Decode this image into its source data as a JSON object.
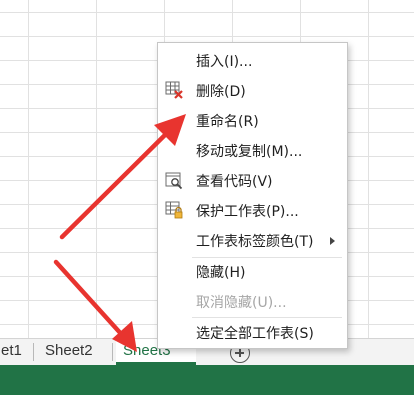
{
  "sheet_tabs": [
    "et1",
    "Sheet2",
    "Sheet3"
  ],
  "active_tab_index": 2,
  "status_text": "",
  "context_menu": {
    "items": [
      {
        "label": "插入(I)...",
        "icon": "insert",
        "disabled": false,
        "submenu": false
      },
      {
        "label": "删除(D)",
        "icon": "delete-sheet-icon",
        "disabled": false,
        "submenu": false
      },
      {
        "label": "重命名(R)",
        "icon": "",
        "disabled": false,
        "submenu": false
      },
      {
        "label": "移动或复制(M)...",
        "icon": "",
        "disabled": false,
        "submenu": false
      },
      {
        "label": "查看代码(V)",
        "icon": "view-code-icon",
        "disabled": false,
        "submenu": false
      },
      {
        "label": "保护工作表(P)...",
        "icon": "protect-sheet-icon",
        "disabled": false,
        "submenu": false
      },
      {
        "label": "工作表标签颜色(T)",
        "icon": "",
        "disabled": false,
        "submenu": true
      },
      {
        "label": "隐藏(H)",
        "icon": "",
        "disabled": false,
        "submenu": false
      },
      {
        "label": "取消隐藏(U)...",
        "icon": "",
        "disabled": true,
        "submenu": false
      },
      {
        "label": "选定全部工作表(S)",
        "icon": "",
        "disabled": false,
        "submenu": false
      }
    ]
  },
  "colors": {
    "accent_green": "#217346",
    "annotation_red": "#e8342f"
  }
}
